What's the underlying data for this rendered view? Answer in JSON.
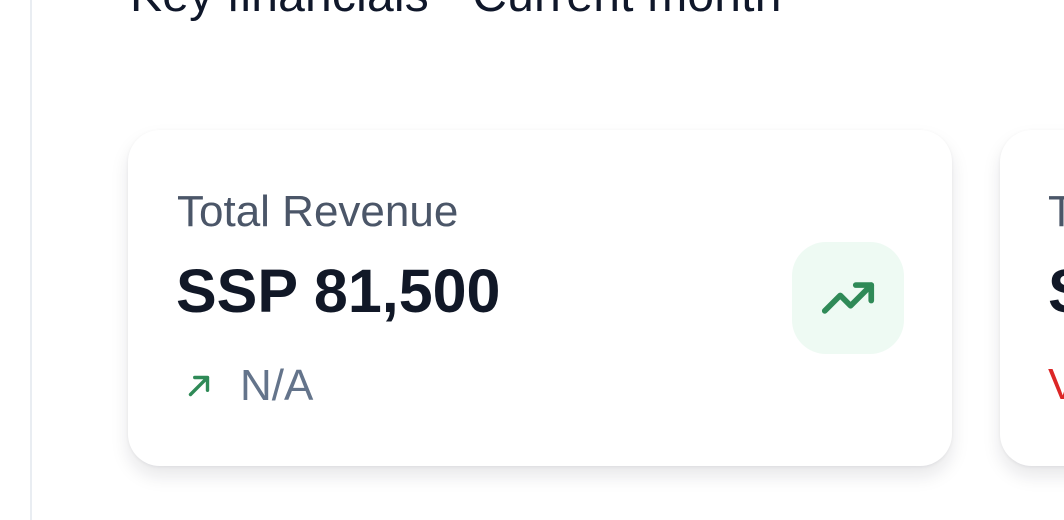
{
  "section": {
    "title": "Key financials - Current month"
  },
  "cards": [
    {
      "label": "Total Revenue",
      "value": "SSP 81,500",
      "trend": {
        "direction": "up",
        "arrow_icon": "arrow-up-right-icon",
        "text": "N/A",
        "color": "#2f8a57"
      },
      "badge": {
        "icon": "trending-up-icon",
        "icon_color": "#2f8a57",
        "background": "#eefaf3"
      }
    },
    {
      "label": "T",
      "value": "S",
      "trend": {
        "text": "V",
        "color": "#dc2626"
      }
    }
  ]
}
